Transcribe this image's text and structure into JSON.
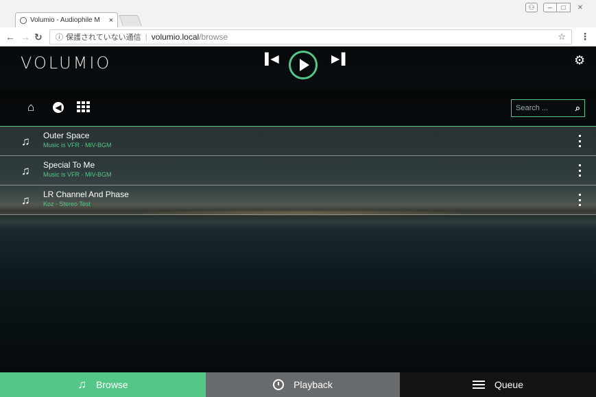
{
  "browser": {
    "tab_title": "Volumio - Audiophile M",
    "tab_close": "×",
    "security_label": "保護されていない通信",
    "url_host": "volumio.local",
    "url_path": "/browse"
  },
  "header": {
    "logo": "VOLUMIO"
  },
  "search": {
    "placeholder": "Search ..."
  },
  "tracks": [
    {
      "title": "Outer Space",
      "artist": "Music is VFR - MiV-BGM"
    },
    {
      "title": "Special To Me",
      "artist": "Music is VFR - MiV-BGM"
    },
    {
      "title": "LR Channel And Phase",
      "artist": "Koz - Stereo Test"
    }
  ],
  "footer": {
    "browse": "Browse",
    "playback": "Playback",
    "queue": "Queue"
  },
  "colors": {
    "accent": "#54c688",
    "playback_tab": "#676b6e",
    "queue_tab": "#121416"
  },
  "icons": {
    "prev": "skip-previous-icon",
    "play": "play-icon",
    "next": "skip-next-icon",
    "settings": "gear-icon",
    "home": "home-icon",
    "back": "back-arrow-icon",
    "grid": "grid-icon",
    "search": "search-icon",
    "track": "music-note-icon",
    "more": "more-vertical-icon"
  }
}
